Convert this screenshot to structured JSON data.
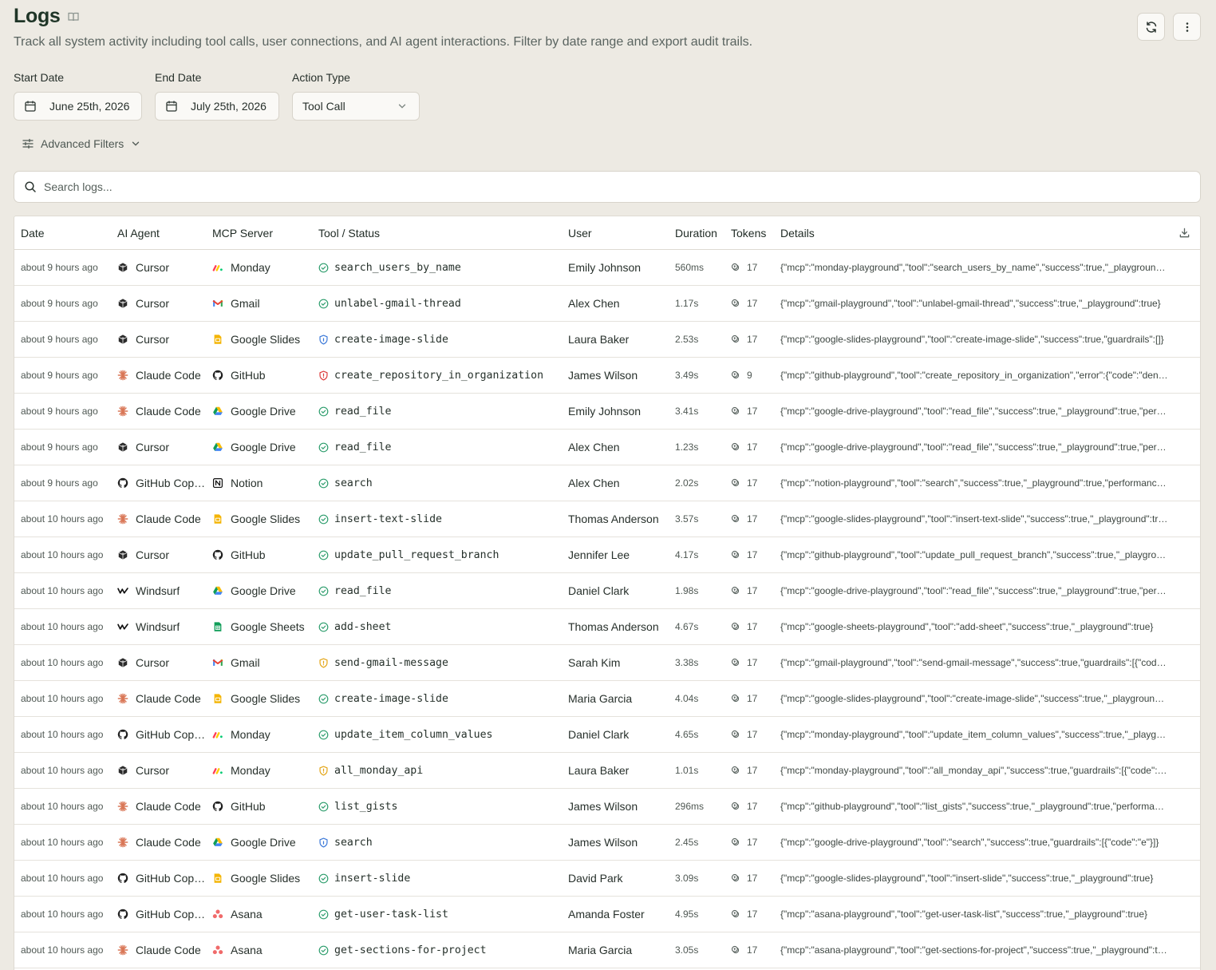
{
  "page": {
    "title": "Logs",
    "subtitle": "Track all system activity including tool calls, user connections, and AI agent interactions. Filter by date range and export audit trails."
  },
  "filters": {
    "start_label": "Start Date",
    "start_value": "June 25th, 2026",
    "end_label": "End Date",
    "end_value": "July 25th, 2026",
    "action_label": "Action Type",
    "action_value": "Tool Call",
    "advanced_label": "Advanced Filters"
  },
  "search": {
    "placeholder": "Search logs..."
  },
  "table": {
    "headers": {
      "date": "Date",
      "agent": "AI Agent",
      "server": "MCP Server",
      "tool": "Tool / Status",
      "user": "User",
      "duration": "Duration",
      "tokens": "Tokens",
      "details": "Details"
    },
    "rows": [
      {
        "date": "about 9 hours ago",
        "agent": "Cursor",
        "agent_icon": "cursor",
        "server": "Monday",
        "server_icon": "monday",
        "tool": "search_users_by_name",
        "status": "success",
        "user": "Emily Johnson",
        "duration": "560ms",
        "tokens": "17",
        "details": "{\"mcp\":\"monday-playground\",\"tool\":\"search_users_by_name\",\"success\":true,\"_playground\":true}"
      },
      {
        "date": "about 9 hours ago",
        "agent": "Cursor",
        "agent_icon": "cursor",
        "server": "Gmail",
        "server_icon": "gmail",
        "tool": "unlabel-gmail-thread",
        "status": "success",
        "user": "Alex Chen",
        "duration": "1.17s",
        "tokens": "17",
        "details": "{\"mcp\":\"gmail-playground\",\"tool\":\"unlabel-gmail-thread\",\"success\":true,\"_playground\":true}"
      },
      {
        "date": "about 9 hours ago",
        "agent": "Cursor",
        "agent_icon": "cursor",
        "server": "Google Slides",
        "server_icon": "slides",
        "tool": "create-image-slide",
        "status": "shield-blue",
        "user": "Laura Baker",
        "duration": "2.53s",
        "tokens": "17",
        "details": "{\"mcp\":\"google-slides-playground\",\"tool\":\"create-image-slide\",\"success\":true,\"guardrails\":[]}"
      },
      {
        "date": "about 9 hours ago",
        "agent": "Claude Code",
        "agent_icon": "claude",
        "server": "GitHub",
        "server_icon": "github",
        "tool": "create_repository_in_organization",
        "status": "shield-red",
        "user": "James Wilson",
        "duration": "3.49s",
        "tokens": "9",
        "details": "{\"mcp\":\"github-playground\",\"tool\":\"create_repository_in_organization\",\"error\":{\"code\":\"denied\"}}"
      },
      {
        "date": "about 9 hours ago",
        "agent": "Claude Code",
        "agent_icon": "claude",
        "server": "Google Drive",
        "server_icon": "drive",
        "tool": "read_file",
        "status": "success",
        "user": "Emily Johnson",
        "duration": "3.41s",
        "tokens": "17",
        "details": "{\"mcp\":\"google-drive-playground\",\"tool\":\"read_file\",\"success\":true,\"_playground\":true,\"performance\":{}}"
      },
      {
        "date": "about 9 hours ago",
        "agent": "Cursor",
        "agent_icon": "cursor",
        "server": "Google Drive",
        "server_icon": "drive",
        "tool": "read_file",
        "status": "success",
        "user": "Alex Chen",
        "duration": "1.23s",
        "tokens": "17",
        "details": "{\"mcp\":\"google-drive-playground\",\"tool\":\"read_file\",\"success\":true,\"_playground\":true,\"performance\":{}}"
      },
      {
        "date": "about 9 hours ago",
        "agent": "GitHub Copilot",
        "agent_icon": "github",
        "server": "Notion",
        "server_icon": "notion",
        "tool": "search",
        "status": "success",
        "user": "Alex Chen",
        "duration": "2.02s",
        "tokens": "17",
        "details": "{\"mcp\":\"notion-playground\",\"tool\":\"search\",\"success\":true,\"_playground\":true,\"performance\":{}}"
      },
      {
        "date": "about 10 hours ago",
        "agent": "Claude Code",
        "agent_icon": "claude",
        "server": "Google Slides",
        "server_icon": "slides",
        "tool": "insert-text-slide",
        "status": "success",
        "user": "Thomas Anderson",
        "duration": "3.57s",
        "tokens": "17",
        "details": "{\"mcp\":\"google-slides-playground\",\"tool\":\"insert-text-slide\",\"success\":true,\"_playground\":true}"
      },
      {
        "date": "about 10 hours ago",
        "agent": "Cursor",
        "agent_icon": "cursor",
        "server": "GitHub",
        "server_icon": "github",
        "tool": "update_pull_request_branch",
        "status": "success",
        "user": "Jennifer Lee",
        "duration": "4.17s",
        "tokens": "17",
        "details": "{\"mcp\":\"github-playground\",\"tool\":\"update_pull_request_branch\",\"success\":true,\"_playground\":true}"
      },
      {
        "date": "about 10 hours ago",
        "agent": "Windsurf",
        "agent_icon": "windsurf",
        "server": "Google Drive",
        "server_icon": "drive",
        "tool": "read_file",
        "status": "success",
        "user": "Daniel Clark",
        "duration": "1.98s",
        "tokens": "17",
        "details": "{\"mcp\":\"google-drive-playground\",\"tool\":\"read_file\",\"success\":true,\"_playground\":true,\"performance\":{}}"
      },
      {
        "date": "about 10 hours ago",
        "agent": "Windsurf",
        "agent_icon": "windsurf",
        "server": "Google Sheets",
        "server_icon": "sheets",
        "tool": "add-sheet",
        "status": "success",
        "user": "Thomas Anderson",
        "duration": "4.67s",
        "tokens": "17",
        "details": "{\"mcp\":\"google-sheets-playground\",\"tool\":\"add-sheet\",\"success\":true,\"_playground\":true}"
      },
      {
        "date": "about 10 hours ago",
        "agent": "Cursor",
        "agent_icon": "cursor",
        "server": "Gmail",
        "server_icon": "gmail",
        "tool": "send-gmail-message",
        "status": "shield-yellow",
        "user": "Sarah Kim",
        "duration": "3.38s",
        "tokens": "17",
        "details": "{\"mcp\":\"gmail-playground\",\"tool\":\"send-gmail-message\",\"success\":true,\"guardrails\":[{\"code\":\"warn\"}]}"
      },
      {
        "date": "about 10 hours ago",
        "agent": "Claude Code",
        "agent_icon": "claude",
        "server": "Google Slides",
        "server_icon": "slides",
        "tool": "create-image-slide",
        "status": "success",
        "user": "Maria Garcia",
        "duration": "4.04s",
        "tokens": "17",
        "details": "{\"mcp\":\"google-slides-playground\",\"tool\":\"create-image-slide\",\"success\":true,\"_playground\":true}"
      },
      {
        "date": "about 10 hours ago",
        "agent": "GitHub Copilot",
        "agent_icon": "github",
        "server": "Monday",
        "server_icon": "monday",
        "tool": "update_item_column_values",
        "status": "success",
        "user": "Daniel Clark",
        "duration": "4.65s",
        "tokens": "17",
        "details": "{\"mcp\":\"monday-playground\",\"tool\":\"update_item_column_values\",\"success\":true,\"_playground\":true}"
      },
      {
        "date": "about 10 hours ago",
        "agent": "Cursor",
        "agent_icon": "cursor",
        "server": "Monday",
        "server_icon": "monday",
        "tool": "all_monday_api",
        "status": "shield-yellow",
        "user": "Laura Baker",
        "duration": "1.01s",
        "tokens": "17",
        "details": "{\"mcp\":\"monday-playground\",\"tool\":\"all_monday_api\",\"success\":true,\"guardrails\":[{\"code\":\"warn\"}]}"
      },
      {
        "date": "about 10 hours ago",
        "agent": "Claude Code",
        "agent_icon": "claude",
        "server": "GitHub",
        "server_icon": "github",
        "tool": "list_gists",
        "status": "success",
        "user": "James Wilson",
        "duration": "296ms",
        "tokens": "17",
        "details": "{\"mcp\":\"github-playground\",\"tool\":\"list_gists\",\"success\":true,\"_playground\":true,\"performance\":{}}"
      },
      {
        "date": "about 10 hours ago",
        "agent": "Claude Code",
        "agent_icon": "claude",
        "server": "Google Drive",
        "server_icon": "drive",
        "tool": "search",
        "status": "shield-blue",
        "user": "James Wilson",
        "duration": "2.45s",
        "tokens": "17",
        "details": "{\"mcp\":\"google-drive-playground\",\"tool\":\"search\",\"success\":true,\"guardrails\":[{\"code\":\"e\"}]}"
      },
      {
        "date": "about 10 hours ago",
        "agent": "GitHub Copilot",
        "agent_icon": "github",
        "server": "Google Slides",
        "server_icon": "slides",
        "tool": "insert-slide",
        "status": "success",
        "user": "David Park",
        "duration": "3.09s",
        "tokens": "17",
        "details": "{\"mcp\":\"google-slides-playground\",\"tool\":\"insert-slide\",\"success\":true,\"_playground\":true}"
      },
      {
        "date": "about 10 hours ago",
        "agent": "GitHub Copilot",
        "agent_icon": "github",
        "server": "Asana",
        "server_icon": "asana",
        "tool": "get-user-task-list",
        "status": "success",
        "user": "Amanda Foster",
        "duration": "4.95s",
        "tokens": "17",
        "details": "{\"mcp\":\"asana-playground\",\"tool\":\"get-user-task-list\",\"success\":true,\"_playground\":true}"
      },
      {
        "date": "about 10 hours ago",
        "agent": "Claude Code",
        "agent_icon": "claude",
        "server": "Asana",
        "server_icon": "asana",
        "tool": "get-sections-for-project",
        "status": "success",
        "user": "Maria Garcia",
        "duration": "3.05s",
        "tokens": "17",
        "details": "{\"mcp\":\"asana-playground\",\"tool\":\"get-sections-for-project\",\"success\":true,\"_playground\":true}"
      }
    ]
  },
  "colors": {
    "background": "#edeae3",
    "success": "#2f9e6e",
    "shield_blue": "#3b78d8",
    "shield_red": "#dc3b3b",
    "shield_yellow": "#e3a516",
    "claude": "#d97757"
  }
}
